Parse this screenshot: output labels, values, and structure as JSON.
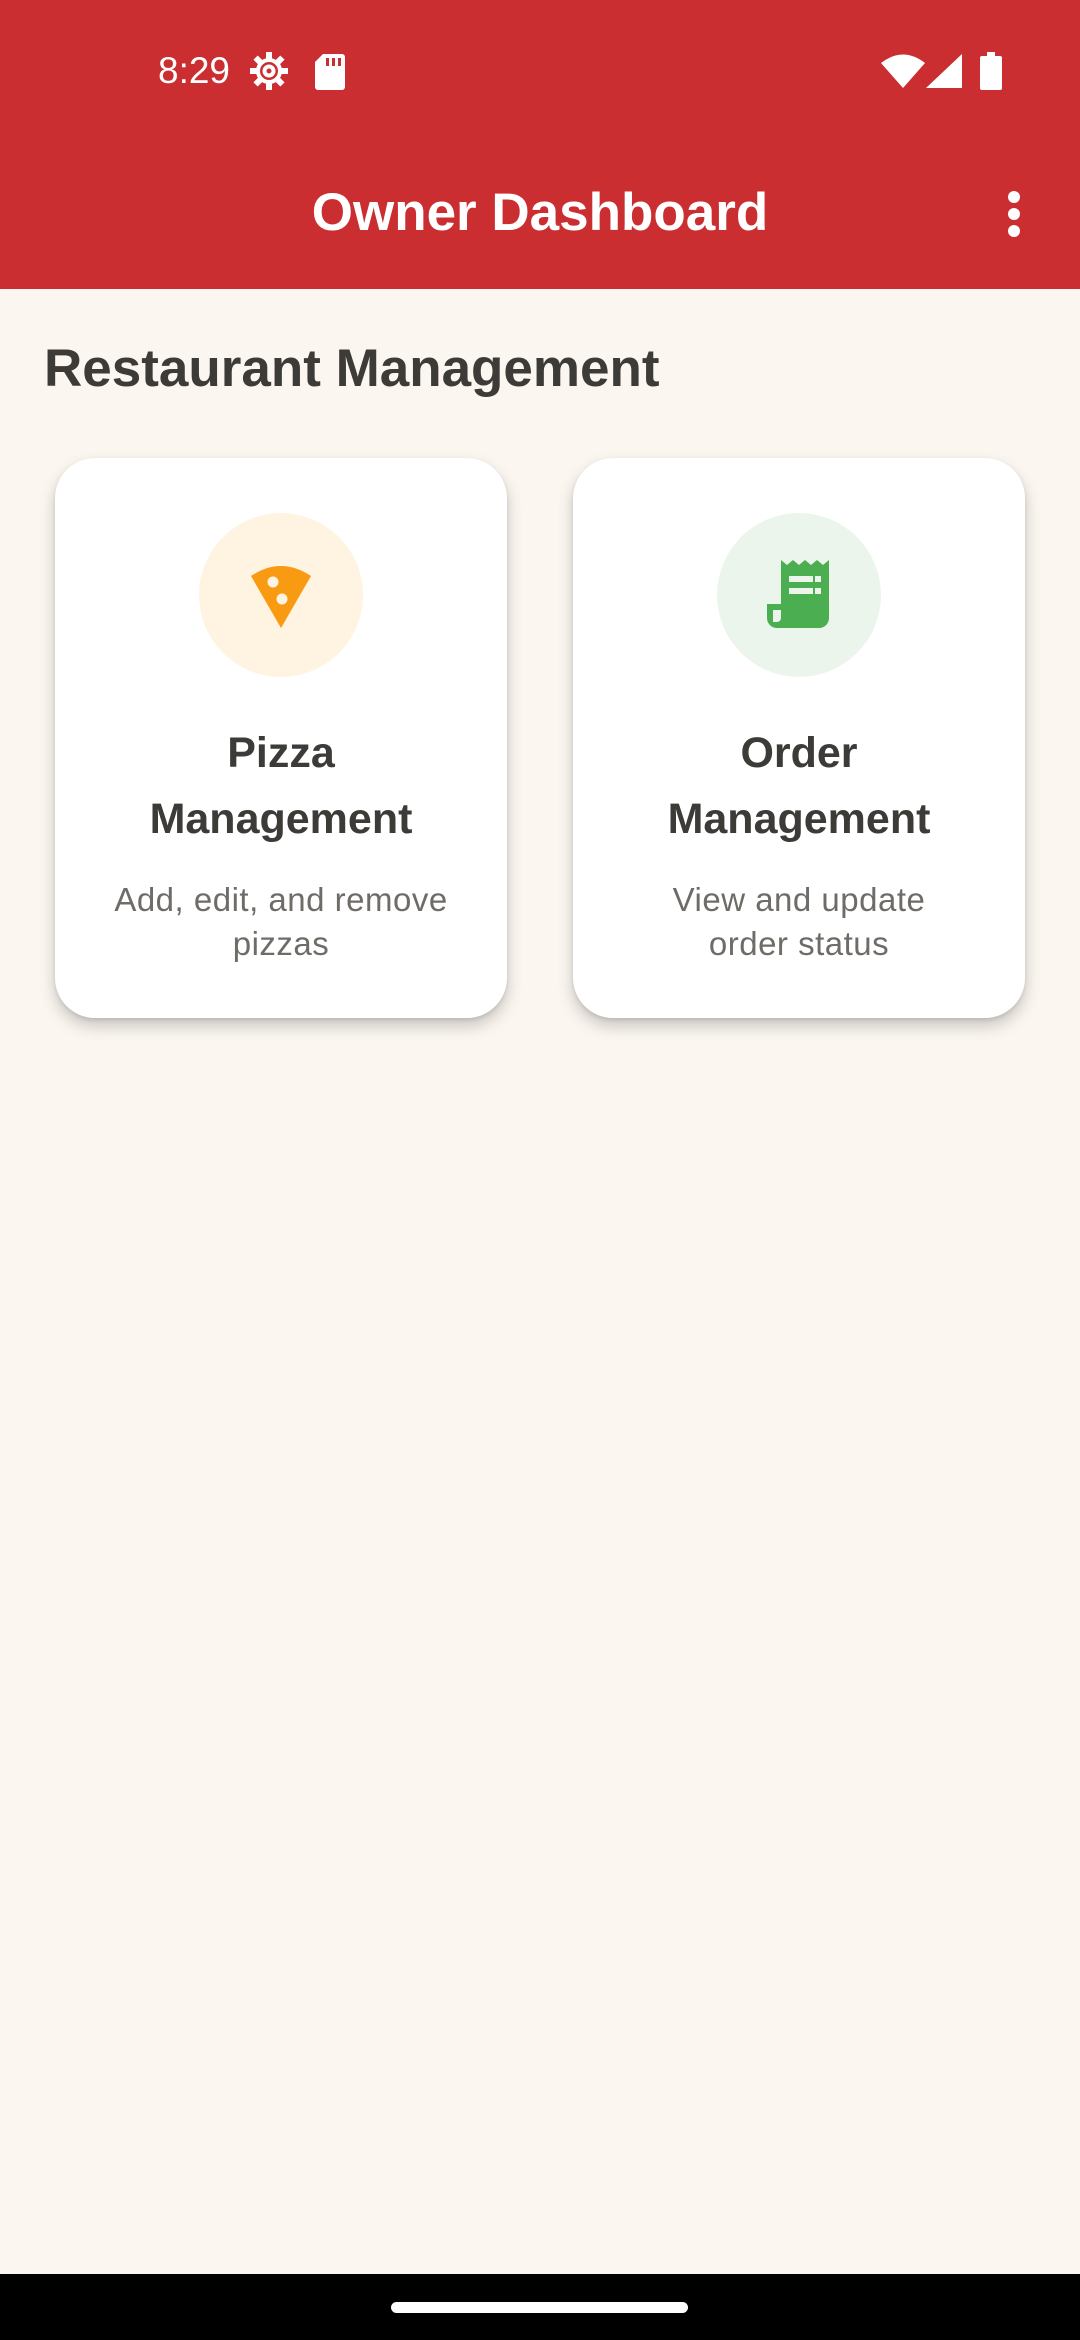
{
  "status_bar": {
    "time": "8:29",
    "icons": [
      "settings-gear-icon",
      "sd-card-icon",
      "wifi-icon",
      "cell-signal-icon",
      "battery-icon"
    ]
  },
  "app_bar": {
    "title": "Owner Dashboard",
    "menu_icon": "more-vert-icon"
  },
  "main": {
    "section_title": "Restaurant Management",
    "cards": [
      {
        "title_line1": "Pizza",
        "title_line2": "Management",
        "desc_line1": "Add, edit, and remove",
        "desc_line2": "pizzas",
        "icon": "pizza-slice-icon"
      },
      {
        "title_line1": "Order",
        "title_line2": "Management",
        "desc_line1": "View and update",
        "desc_line2": "order status",
        "icon": "receipt-icon"
      }
    ]
  },
  "colors": {
    "app_bar": "#CB2E30",
    "background": "#FBF6F0",
    "pizza_accent": "#F99A13",
    "pizza_circle": "#FFF3E2",
    "order_accent": "#4BAE50",
    "order_circle": "#EBF5EC",
    "title_text": "#3D3B38",
    "desc_text": "#6F6C68"
  }
}
